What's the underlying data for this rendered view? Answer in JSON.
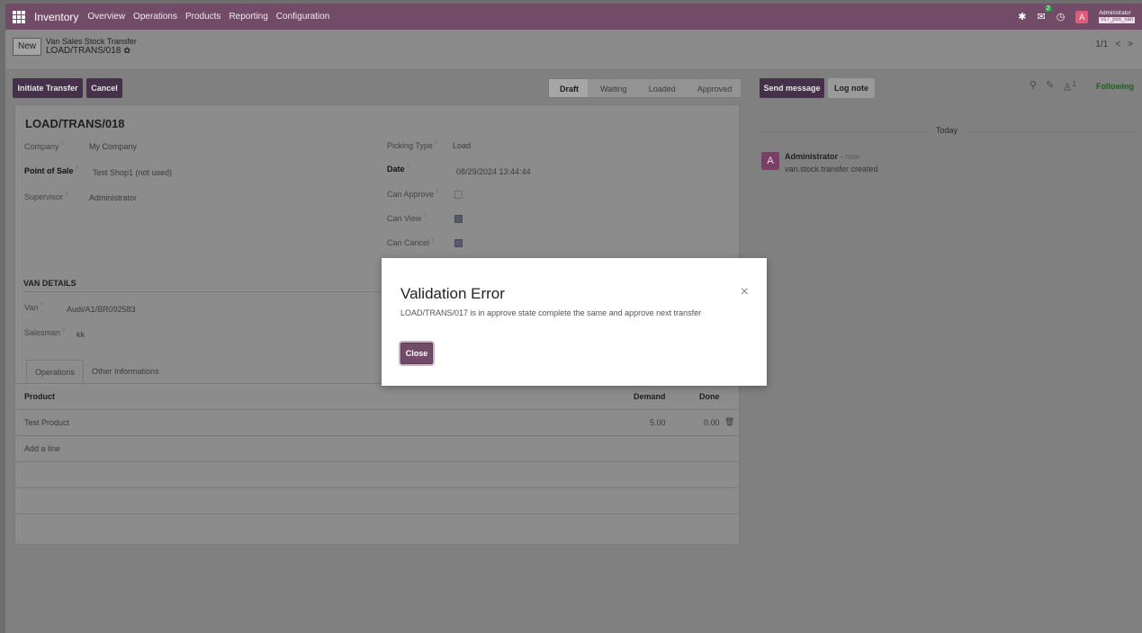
{
  "nav": {
    "app_title": "Inventory",
    "menu": [
      "Overview",
      "Operations",
      "Products",
      "Reporting",
      "Configuration"
    ],
    "chat_badge": "2",
    "user_name": "Administrator",
    "user_db": "v17_pos_van",
    "avatar_letter": "A"
  },
  "control": {
    "new_label": "New",
    "breadcrumb_parent": "Van Sales Stock Transfer",
    "breadcrumb_record": "LOAD/TRANS/018",
    "pager": "1/1",
    "prev": "<",
    "next": ">",
    "initiate_label": "Initiate Transfer",
    "cancel_label": "Cancel",
    "stages": [
      "Draft",
      "Waiting",
      "Loaded",
      "Approved"
    ]
  },
  "form": {
    "title": "LOAD/TRANS/018",
    "company_label": "Company",
    "company_value": "My Company",
    "pos_label": "Point of Sale",
    "pos_value": "Test Shop1 (not used)",
    "supervisor_label": "Supervisor",
    "supervisor_value": "Administrator",
    "picking_label": "Picking Type",
    "picking_value": "Load",
    "date_label": "Date",
    "date_value": "08/29/2024 13:44:44",
    "can_approve_label": "Can Approve",
    "can_view_label": "Can View",
    "can_cancel_label": "Can Cancel",
    "help_mark": "?",
    "van_section": "VAN DETAILS",
    "van_label": "Van",
    "van_value": "Audi/A1/BR092583",
    "salesman_label": "Salesman",
    "salesman_value": "kk",
    "tabs": [
      "Operations",
      "Other Informations"
    ],
    "table_headers": {
      "product": "Product",
      "demand": "Demand",
      "done": "Done"
    },
    "rows": [
      {
        "product": "Test Product",
        "demand": "5.00",
        "done": "0.00"
      }
    ],
    "add_line": "Add a line"
  },
  "chatter": {
    "send_message": "Send message",
    "log_note": "Log note",
    "followers_count": "1",
    "following": "Following",
    "today": "Today",
    "author": "Administrator",
    "time": "- now",
    "body": "van.stock.transfer created",
    "avatar_letter": "A"
  },
  "modal": {
    "title": "Validation Error",
    "body": "LOAD/TRANS/017 is in approve state complete the same and approve next transfer",
    "close_label": "Close",
    "x": "×"
  }
}
